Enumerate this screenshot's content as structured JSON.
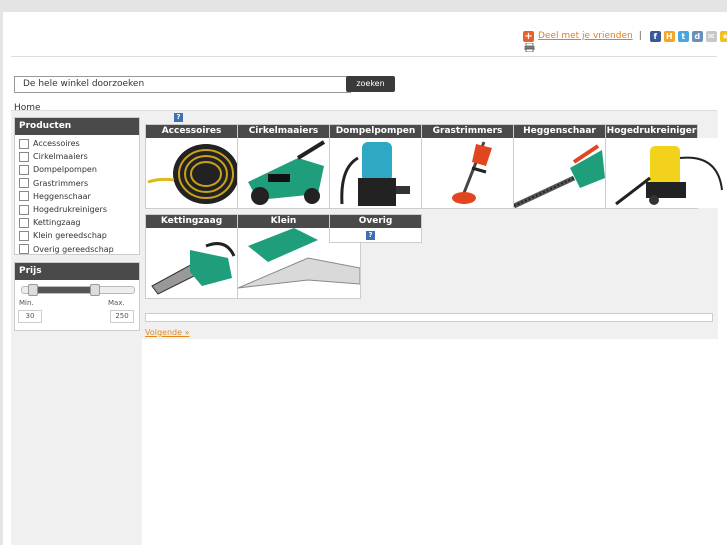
{
  "share": {
    "label": "Deel met je vrienden",
    "separator": "|"
  },
  "search": {
    "placeholder": "De hele winkel doorzoeken",
    "button": "zoeken"
  },
  "breadcrumb": "Home",
  "sidebar": {
    "products_title": "Producten",
    "products": [
      "Accessoires",
      "Cirkelmaaiers",
      "Dompelpompen",
      "Grastrimmers",
      "Heggenschaar",
      "Hogedrukreinigers",
      "Kettingzaag",
      "Klein gereedschap",
      "Overig gereedschap"
    ],
    "price_title": "Prijs",
    "min_label": "Min.",
    "max_label": "Max.",
    "min_value": "30",
    "max_value": "250"
  },
  "categories": [
    {
      "name": "Accessoires",
      "icon": "hose-reel-image"
    },
    {
      "name": "Cirkelmaaiers",
      "icon": "lawn-mower-image"
    },
    {
      "name": "Dompelpompen",
      "icon": "submersible-pump-image"
    },
    {
      "name": "Grastrimmers",
      "icon": "grass-trimmer-image"
    },
    {
      "name": "Heggenschaar",
      "icon": "hedge-trimmer-image"
    },
    {
      "name": "Hogedrukreiniger",
      "icon": "pressure-washer-image"
    },
    {
      "name": "Kettingzaag",
      "icon": "chainsaw-image"
    },
    {
      "name": "Klein",
      "icon": "grass-shears-image"
    },
    {
      "name": "Overig",
      "icon": "missing-image"
    }
  ],
  "pagination": {
    "next": "Volgende »"
  },
  "colors": {
    "header_bg": "#4a4a4a",
    "link": "#e0801c",
    "accent_green": "#1e9e7a"
  }
}
